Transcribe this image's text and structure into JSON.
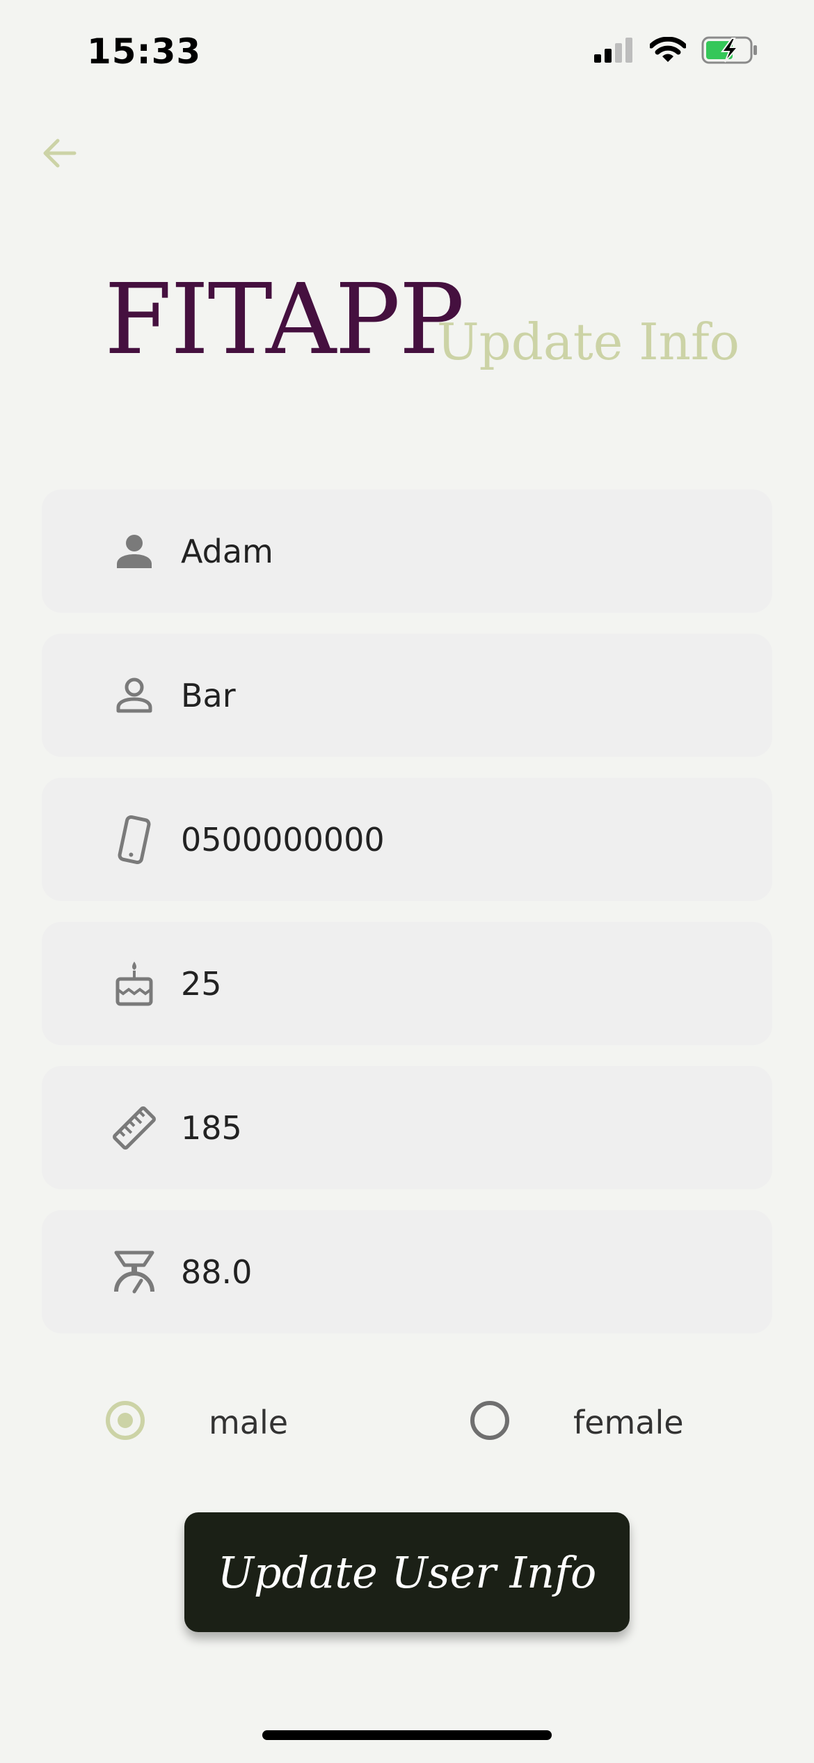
{
  "status_bar": {
    "time": "15:33",
    "icons": [
      "signal-icon",
      "wifi-icon",
      "battery-charging-icon"
    ]
  },
  "header": {
    "back_icon": "arrow-left-icon",
    "brand": "FITAPP",
    "subtitle": "Update Info"
  },
  "form": {
    "fields": [
      {
        "icon": "person-icon",
        "value": "Adam"
      },
      {
        "icon": "person-outline-icon",
        "value": "Bar"
      },
      {
        "icon": "phone-icon",
        "value": "0500000000"
      },
      {
        "icon": "cake-icon",
        "value": "25"
      },
      {
        "icon": "ruler-icon",
        "value": "185"
      },
      {
        "icon": "scale-icon",
        "value": "88.0"
      }
    ],
    "gender": {
      "options": [
        "male",
        "female"
      ],
      "selected": "male"
    },
    "submit_label": "Update User Info"
  },
  "colors": {
    "background": "#f3f4f1",
    "brand": "#45103f",
    "accent": "#ccd3a6",
    "field_bg": "#efefef",
    "button_bg": "#1b2016",
    "icon_gray": "#7a7a7a"
  }
}
